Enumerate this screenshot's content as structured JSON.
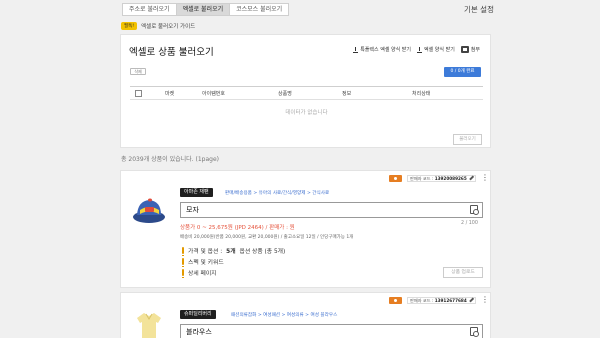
{
  "tabs": [
    {
      "label": "주소로 불러오기",
      "active": false
    },
    {
      "label": "엑셀로 불러오기",
      "active": true
    },
    {
      "label": "코스모스 불러오기",
      "active": false
    }
  ],
  "settings_label": "기본 설정",
  "help": {
    "badge": "필독!",
    "text": "엑셀로 불러오기 가이드"
  },
  "import_panel": {
    "title": "엑셀로 상품 불러오기",
    "actions": [
      {
        "label": "특플렉스 엑셀 양식 받기",
        "icon": "download-icon"
      },
      {
        "label": "엑셀 양식 받기",
        "icon": "download-icon"
      },
      {
        "label": "첨부",
        "icon": "excel-icon"
      }
    ],
    "small_button": "삭제",
    "status_button": "0 / 0개 완료",
    "columns": [
      "마켓",
      "아이템번호",
      "상품명",
      "정보",
      "처리상태"
    ],
    "empty_text": "데이터가 없습니다",
    "import_button": "불러오기"
  },
  "product_count_text": "총 2039개 상품이 있습니다. (1page)",
  "products": [
    {
      "seller_code_label": "판매자 코드 :",
      "seller_code": "13920089265",
      "market_tag": "아마존 재팬",
      "breadcrumb": "판매/배송용품 > 유아의 사료/간식/영양제 > 간식사료",
      "name": "모자",
      "char_count": "2 / 100",
      "price_text": "상품가 0 ~ 25,675원 (JPD 2464) / 판매가 : 원",
      "shipping_text": "배송비 20,000원(반품 20,000원, 교환 20,000원) / 출고소요일 12일 / 인당구매가능 1개",
      "option_row": {
        "prefix": "가격 및 옵션 :",
        "count": "5개",
        "suffix": "옵션 상품 (총 5개)"
      },
      "search_row": "스펙 및 키워드",
      "detail_row": "상세 페이지",
      "upload_button": "상품 업로드",
      "image": "hat"
    },
    {
      "seller_code_label": "판매자 코드 :",
      "seller_code": "13912677684",
      "market_tag": "슈퍼딜리버리",
      "breadcrumb": "패션의류잡화 > 여성패션 > 여성의류 > 여성 블라우스",
      "name": "블라우스",
      "image": "blouse"
    }
  ],
  "colors": {
    "accent_blue": "#3d7bd9",
    "warning_orange": "#e39a00",
    "price_red": "#e5533c",
    "seller_orange": "#e67e22"
  }
}
